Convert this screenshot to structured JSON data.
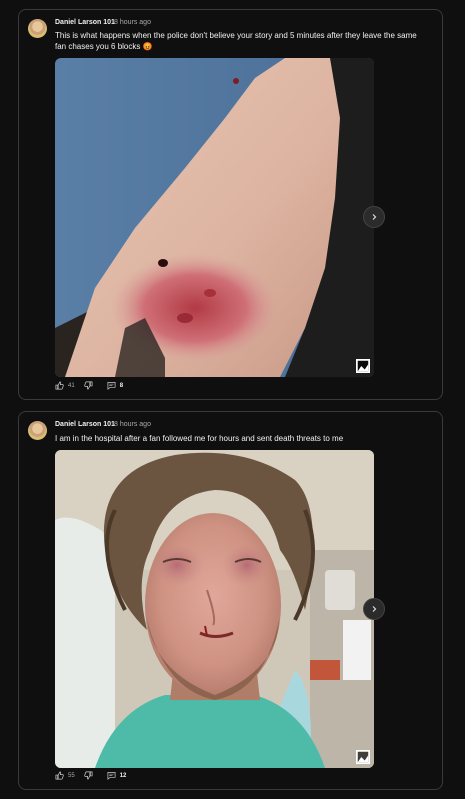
{
  "posts": [
    {
      "author": "Daniel Larson 101",
      "time": "8 hours ago",
      "text": "This is what happens when the police don't believe your story and 5 minutes after they leave the same fan chases you 6 blocks 😡",
      "likes": "41",
      "comments": "8"
    },
    {
      "author": "Daniel Larson 101",
      "time": "8 hours ago",
      "text": "I am in the hospital after a fan followed me for hours and sent death threats to me",
      "likes": "55",
      "comments": "12"
    }
  ],
  "icons": {
    "like": "thumb-up-icon",
    "dislike": "thumb-down-icon",
    "comment": "comment-icon",
    "next": "chevron-right-icon",
    "image": "image-icon"
  }
}
